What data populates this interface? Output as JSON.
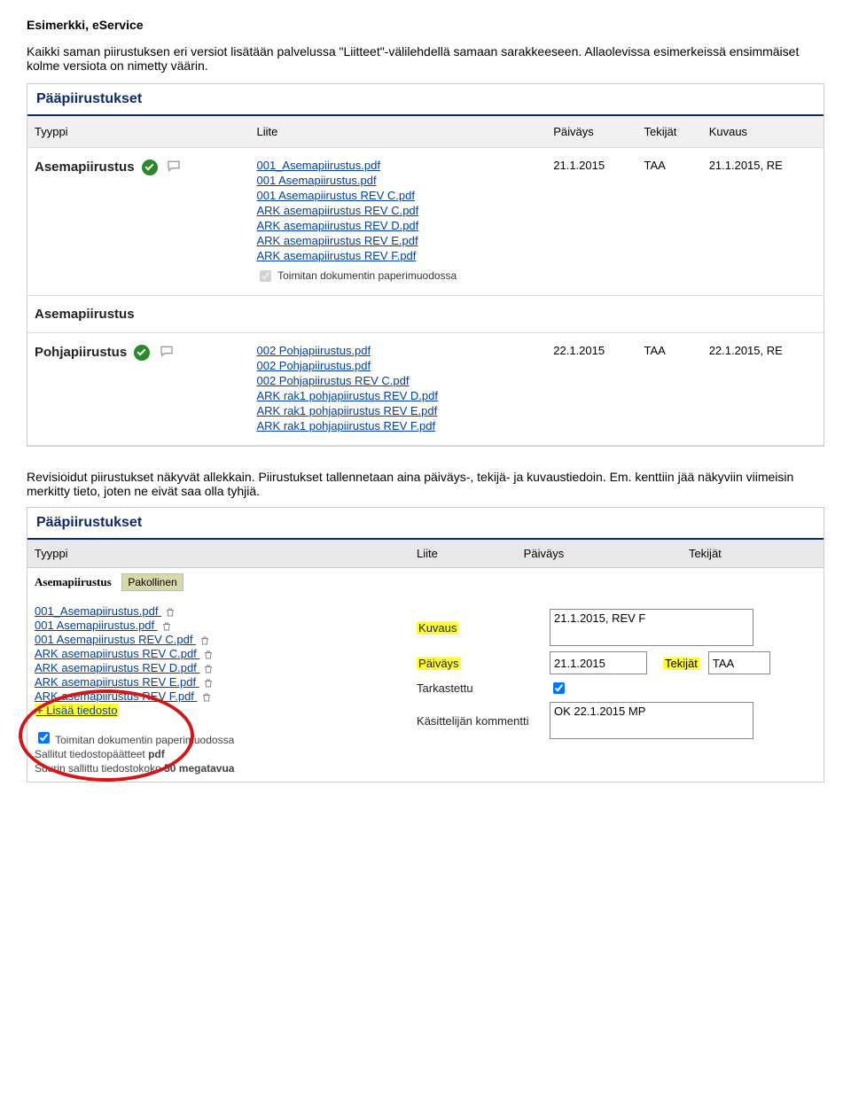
{
  "doc": {
    "title": "Esimerkki, eService",
    "intro": "Kaikki saman piirustuksen eri versiot lisätään palvelussa \"Liitteet\"-välilehdellä samaan sarakkeeseen. Allaolevissa esimerkeissä ensimmäiset kolme versiota on nimetty väärin.",
    "mid": "Revisioidut piirustukset näkyvät allekkain. Piirustukset tallennetaan aina päiväys-, tekijä- ja kuvaustiedoin. Em. kenttiin jää näkyviin viimeisin merkitty tieto, joten ne eivät saa olla tyhjiä."
  },
  "panel1": {
    "heading": "Pääpiirustukset",
    "cols": [
      "Tyyppi",
      "Liite",
      "Päiväys",
      "Tekijät",
      "Kuvaus"
    ],
    "rows": [
      {
        "tyyppi": "Asemapiirustus",
        "ok": true,
        "links": [
          "001_Asemapiirustus.pdf",
          "001 Asemapiirustus.pdf",
          "001 Asemapiirustus REV C.pdf",
          "ARK asemapiirustus REV C.pdf",
          "ARK asemapiirustus REV D.pdf",
          "ARK asemapiirustus REV E.pdf",
          "ARK asemapiirustus REV F.pdf"
        ],
        "paper": "Toimitan dokumentin paperimuodossa",
        "pvm": "21.1.2015",
        "tek": "TAA",
        "kuv": "21.1.2015, RE"
      },
      {
        "tyyppi": "Asemapiirustus",
        "ok": false,
        "links": [],
        "paper": "",
        "pvm": "",
        "tek": "",
        "kuv": ""
      },
      {
        "tyyppi": "Pohjapiirustus",
        "ok": true,
        "links": [
          "002 Pohjapiirustus.pdf",
          "002 Pohjapiirustus.pdf",
          "002 Pohjapiirustus REV C.pdf",
          "ARK rak1 pohjapiirustus REV D.pdf",
          "ARK rak1 pohjapiirustus REV E.pdf",
          "ARK rak1 pohjapiirustus REV F.pdf"
        ],
        "paper": "",
        "pvm": "22.1.2015",
        "tek": "TAA",
        "kuv": "22.1.2015, RE"
      }
    ]
  },
  "panel2": {
    "heading": "Pääpiirustukset",
    "cols": [
      "Tyyppi",
      "Liite",
      "Päiväys",
      "Tekijät"
    ],
    "rowhead": {
      "tyyppi": "Asemapiirustus",
      "pak": "Pakollinen"
    },
    "files": [
      "001_Asemapiirustus.pdf",
      "001 Asemapiirustus.pdf",
      "001 Asemapiirustus REV C.pdf",
      "ARK asemapiirustus REV C.pdf",
      "ARK asemapiirustus REV D.pdf",
      "ARK asemapiirustus REV E.pdf",
      "ARK asemapiirustus REV F.pdf"
    ],
    "add": "Lisää tiedosto",
    "form": {
      "kuvaus_lab": "Kuvaus",
      "kuvaus_val": "21.1.2015, REV F",
      "pvm_lab": "Päiväys",
      "pvm_val": "21.1.2015",
      "tek_lab": "Tekijät",
      "tek_val": "TAA",
      "tark_lab": "Tarkastettu",
      "kom_lab": "Käsittelijän kommentti",
      "kom_val": "OK 22.1.2015 MP"
    },
    "foot": {
      "paper": "Toimitan dokumentin paperimuodossa",
      "line1a": "Sallitut tiedostopäätteet ",
      "line1b": "pdf",
      "line2a": "Suurin sallittu tiedostokoko ",
      "line2b": "50 megatavua"
    }
  }
}
